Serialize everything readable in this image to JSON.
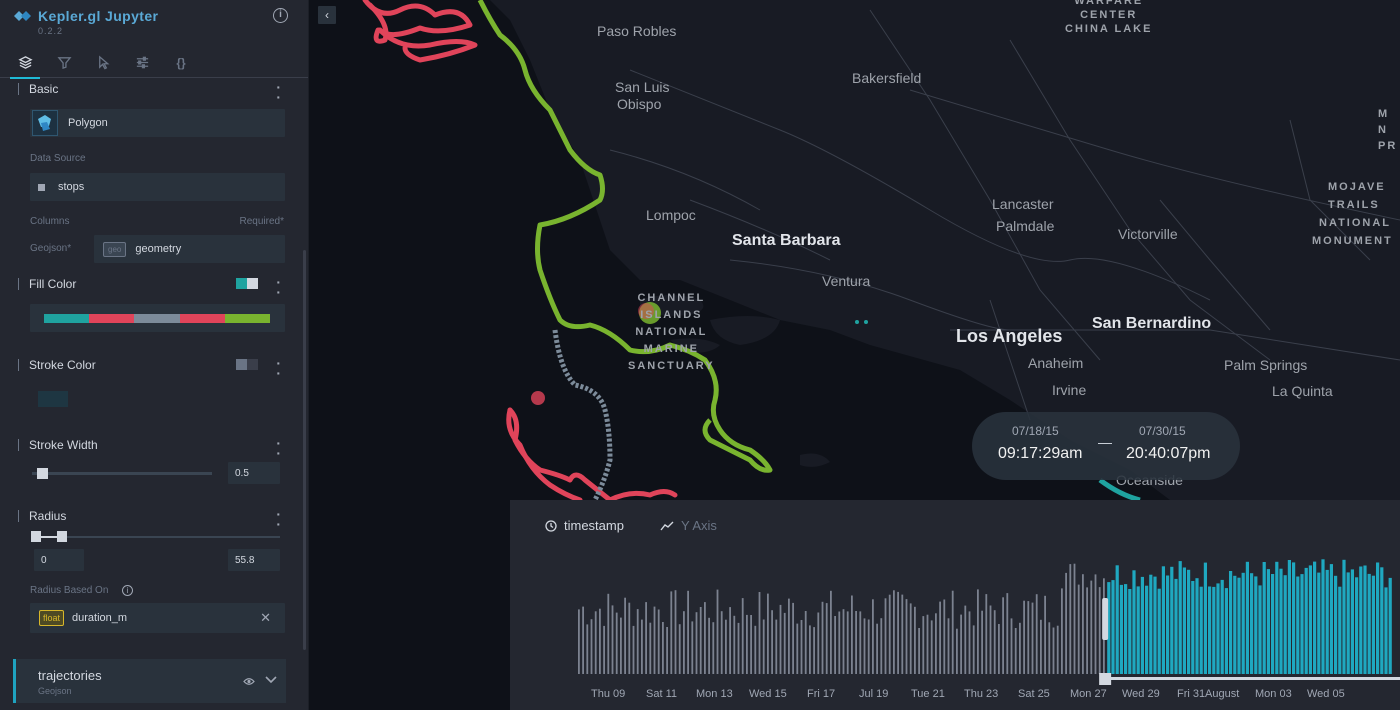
{
  "app": {
    "title": "Kepler.gl Jupyter",
    "version": "0.2.2",
    "info_icon": "info-icon"
  },
  "tabs": [
    {
      "name": "layers",
      "icon": "layers-icon",
      "active": true
    },
    {
      "name": "filters",
      "icon": "filter-icon"
    },
    {
      "name": "interactions",
      "icon": "cursor-icon"
    },
    {
      "name": "base-map",
      "icon": "sliders-icon"
    },
    {
      "name": "config",
      "icon": "braces-icon",
      "text": "{}"
    }
  ],
  "layer": {
    "basic_label": "Basic",
    "type_label": "Polygon",
    "data_source_label": "Data Source",
    "data_source_value": "stops",
    "columns_label": "Columns",
    "required_label": "Required*",
    "geojson_label": "Geojson*",
    "geojson_badge": "geo",
    "geojson_value": "geometry",
    "fill_color_label": "Fill Color",
    "fill_palette": [
      "#1fa3a0",
      "#e0445a",
      "#7c8b9a",
      "#e0445a",
      "#79b42f"
    ],
    "stroke_color_label": "Stroke Color",
    "stroke_width_label": "Stroke Width",
    "stroke_width_value": "0.5",
    "stroke_width_level": 0.03,
    "radius_label": "Radius",
    "radius_min": "0",
    "radius_max": "55.8",
    "radius_based_on_label": "Radius Based On",
    "radius_field_badge": "float",
    "radius_field_value": "duration_m"
  },
  "second_layer": {
    "name": "trajectories",
    "type": "Geojson"
  },
  "map": {
    "cities": [
      {
        "id": "paso-robles",
        "label": "Paso Robles"
      },
      {
        "id": "san-luis-obispo-1",
        "label": "San Luis"
      },
      {
        "id": "san-luis-obispo-2",
        "label": "Obispo"
      },
      {
        "id": "bakersfield",
        "label": "Bakersfield"
      },
      {
        "id": "lompoc",
        "label": "Lompoc"
      },
      {
        "id": "santa-barbara",
        "label": "Santa Barbara"
      },
      {
        "id": "ventura",
        "label": "Ventura"
      },
      {
        "id": "lancaster",
        "label": "Lancaster"
      },
      {
        "id": "palmdale",
        "label": "Palmdale"
      },
      {
        "id": "victorville",
        "label": "Victorville"
      },
      {
        "id": "los-angeles",
        "label": "Los Angeles"
      },
      {
        "id": "san-bernardino",
        "label": "San Bernardino"
      },
      {
        "id": "anaheim",
        "label": "Anaheim"
      },
      {
        "id": "irvine",
        "label": "Irvine"
      },
      {
        "id": "palm-springs",
        "label": "Palm Springs"
      },
      {
        "id": "la-quinta",
        "label": "La Quinta"
      },
      {
        "id": "oceanside",
        "label": "Oceanside"
      }
    ],
    "china_lake_1": "WARFARE",
    "china_lake_2": "CENTER",
    "china_lake_3": "CHINA LAKE",
    "mojave_1": "MOJAVE",
    "mojave_2": "TRAILS",
    "mojave_3": "NATIONAL",
    "mojave_4": "MONUMENT",
    "channel_1": "CHANNEL",
    "channel_2": "ISLANDS",
    "channel_3": "NATIONAL",
    "channel_4": "MARINE",
    "channel_5": "SANCTUARY",
    "edge_1": "M",
    "edge_2": "N",
    "edge_3": "PR"
  },
  "time_range": {
    "start_date": "07/18/15",
    "start_time": "09:17:29am",
    "end_date": "07/30/15",
    "end_time": "20:40:07pm",
    "separator": "—"
  },
  "histogram": {
    "x_field": "timestamp",
    "y_label": "Y Axis",
    "axis_labels": [
      "Thu 09",
      "Sat 11",
      "Mon 13",
      "Wed 15",
      "Fri 17",
      "Jul 19",
      "Tue 21",
      "Thu 23",
      "Sat 25",
      "Mon 27",
      "Wed 29",
      "Fri 31",
      "August",
      "Mon 03",
      "Wed 05"
    ],
    "selection": {
      "from_day": 18.39,
      "to_day": 30.86
    },
    "colors": {
      "selected": "#1fa8c0",
      "unselected": "#7c8290"
    }
  }
}
